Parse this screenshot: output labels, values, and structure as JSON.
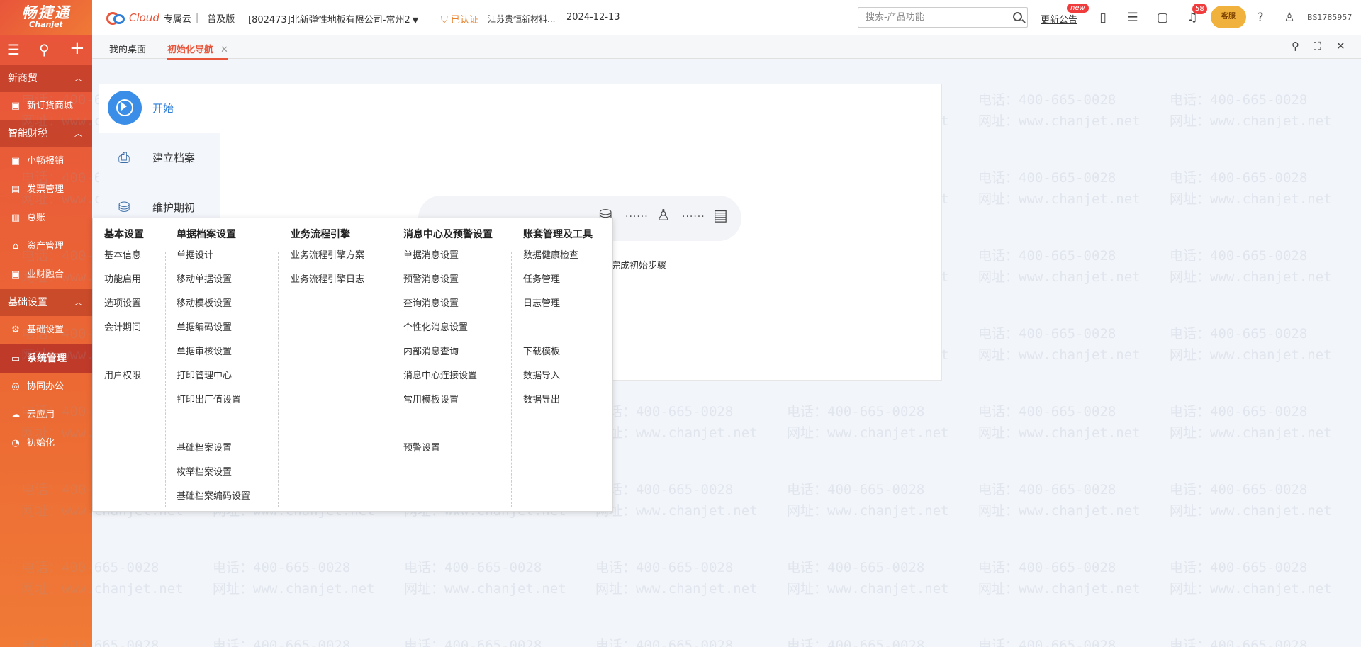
{
  "brand": {
    "cn": "畅捷通",
    "en": "Chanjet",
    "cloud": "Cloud",
    "edition": "专属云",
    "sub_edition": "普及版"
  },
  "header": {
    "company": "[802473]北新弹性地板有限公司-常州2",
    "verified_label": "已认证",
    "verified_company": "江苏贵恒新材料...",
    "date": "2024-12-13",
    "notice": "更新公告",
    "new_badge": "new",
    "bell_count": "58",
    "kefu": "客服",
    "user": "BS1785957"
  },
  "search": {
    "placeholder": "搜索-产品功能",
    "value": ""
  },
  "sidebar": {
    "groups": [
      {
        "label": "新商贸",
        "items": [
          {
            "label": "新订货商城",
            "icon": "store-icon"
          }
        ]
      },
      {
        "label": "智能财税",
        "items": [
          {
            "label": "小畅报销",
            "icon": "reimburse-icon"
          },
          {
            "label": "发票管理",
            "icon": "invoice-icon"
          },
          {
            "label": "总账",
            "icon": "ledger-icon"
          },
          {
            "label": "资产管理",
            "icon": "asset-icon"
          },
          {
            "label": "业财融合",
            "icon": "integration-icon"
          }
        ]
      },
      {
        "label": "基础设置",
        "items": [
          {
            "label": "基础设置",
            "icon": "settings-icon"
          },
          {
            "label": "系统管理",
            "icon": "system-icon"
          },
          {
            "label": "协同办公",
            "icon": "collab-icon"
          },
          {
            "label": "云应用",
            "icon": "cloud-icon"
          },
          {
            "label": "初始化",
            "icon": "init-icon"
          }
        ]
      }
    ]
  },
  "tabs": [
    {
      "label": "我的桌面"
    },
    {
      "label": "初始化导航"
    }
  ],
  "init": {
    "steps": [
      {
        "label": "开始"
      },
      {
        "label": "建立档案"
      },
      {
        "label": "维护期初"
      }
    ],
    "hint": "完成初始步骤"
  },
  "menu": {
    "columns": [
      {
        "title": "基本设置",
        "links": [
          "基本信息",
          "功能启用",
          "选项设置",
          "会计期间",
          "",
          "用户权限"
        ]
      },
      {
        "title": "单据档案设置",
        "links": [
          "单据设计",
          "移动单据设置",
          "移动模板设置",
          "单据编码设置",
          "单据审核设置",
          "打印管理中心",
          "打印出厂值设置",
          "",
          "基础档案设置",
          "枚举档案设置",
          "基础档案编码设置"
        ]
      },
      {
        "title": "业务流程引擎",
        "links": [
          "业务流程引擎方案",
          "业务流程引擎日志"
        ]
      },
      {
        "title": "消息中心及预警设置",
        "links": [
          "单据消息设置",
          "预警消息设置",
          "查询消息设置",
          "个性化消息设置",
          "内部消息查询",
          "消息中心连接设置",
          "常用模板设置",
          "",
          "预警设置"
        ]
      },
      {
        "title": "账套管理及工具",
        "links": [
          "数据健康检查",
          "任务管理",
          "日志管理",
          "",
          "下载模板",
          "数据导入",
          "数据导出"
        ]
      }
    ]
  },
  "watermark": {
    "phone": "电话：400-665-0028",
    "site": "网址：www.chanjet.net"
  },
  "colors": {
    "accent": "#e8553a",
    "blue": "#2f7fd8",
    "badge": "#f03c3c"
  }
}
